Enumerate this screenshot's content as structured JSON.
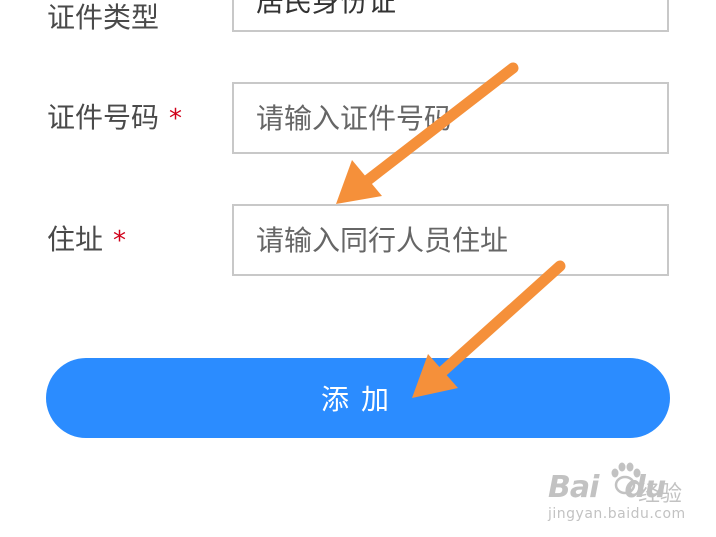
{
  "form": {
    "id_type": {
      "label": "证件类型",
      "value": "居民身份证"
    },
    "id_number": {
      "label": "证件号码",
      "required_mark": "*",
      "placeholder": "请输入证件号码"
    },
    "address": {
      "label": "住址",
      "required_mark": "*",
      "placeholder": "请输入同行人员住址"
    },
    "submit_label": "添加"
  },
  "watermark": {
    "logo_text": "Bai",
    "logo_suffix": "du",
    "product": "经验",
    "url": "jingyan.baidu.com"
  },
  "colors": {
    "primary_button": "#2b8cff",
    "required_star": "#d0021b",
    "arrow": "#f5903a",
    "input_border": "#c8c8c8"
  },
  "icons": [
    "arrow-annotation-icon",
    "baidu-paw-icon"
  ]
}
